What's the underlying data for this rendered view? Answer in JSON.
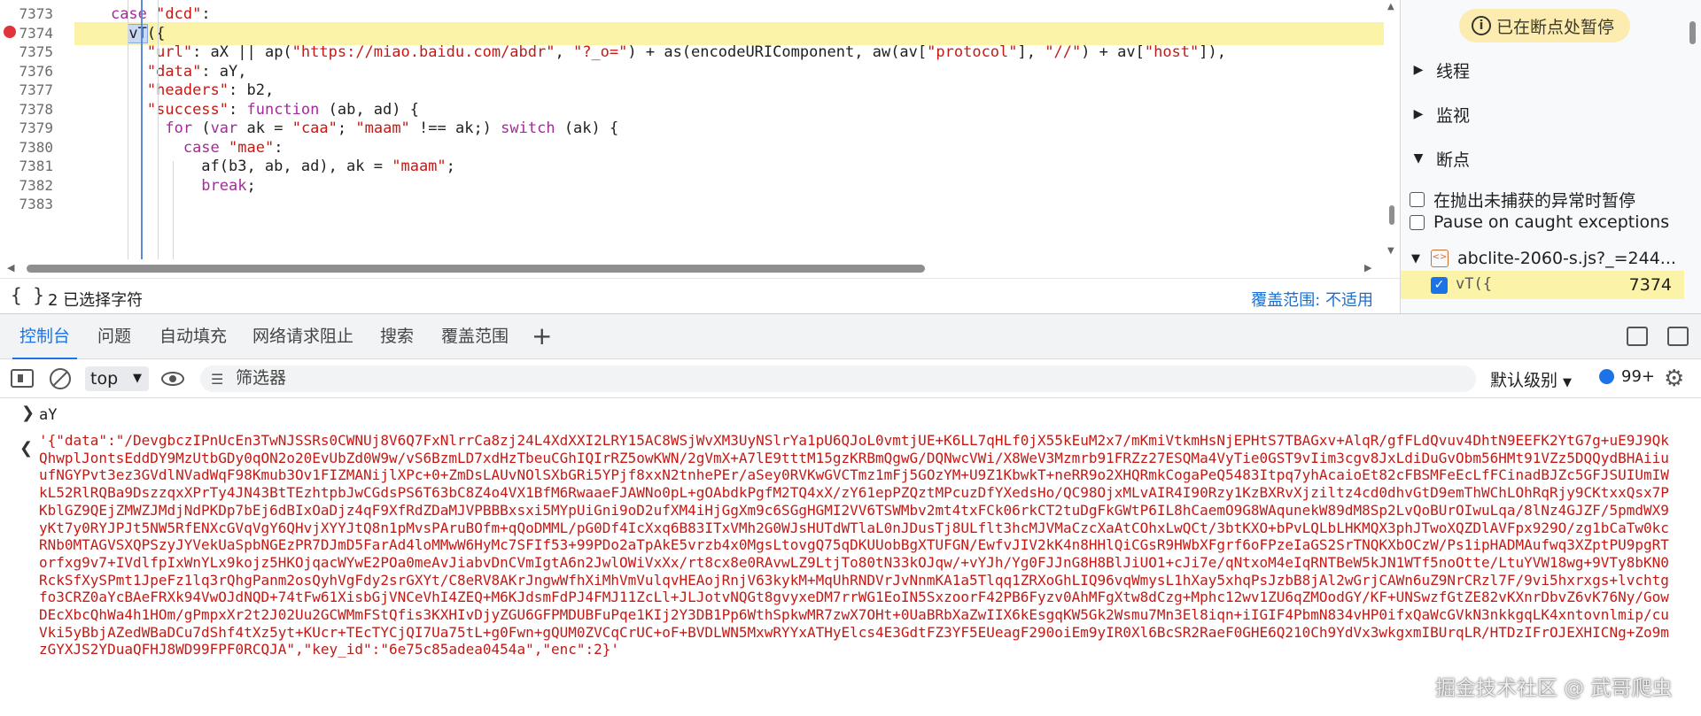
{
  "editor": {
    "line_numbers": [
      "7373",
      "7374",
      "7375",
      "7376",
      "7377",
      "7378",
      "7379",
      "7380",
      "7381",
      "7382",
      "7383"
    ],
    "paused_line": "7374",
    "lines": [
      [
        {
          "t": "    "
        },
        {
          "t": "case ",
          "c": "kw"
        },
        {
          "t": "\"dcd\"",
          "c": "str"
        },
        {
          "t": ":"
        }
      ],
      [
        {
          "t": "      "
        },
        {
          "t": "vT",
          "c": "sel"
        },
        {
          "t": "({"
        }
      ],
      [
        {
          "t": "        "
        },
        {
          "t": "\"url\"",
          "c": "str"
        },
        {
          "t": ": aX || ap("
        },
        {
          "t": "\"https://miao.baidu.com/abdr\"",
          "c": "str"
        },
        {
          "t": ", "
        },
        {
          "t": "\"?_o=\"",
          "c": "str"
        },
        {
          "t": ") + as(encodeURIComponent, aw(av["
        },
        {
          "t": "\"protocol\"",
          "c": "str"
        },
        {
          "t": "], "
        },
        {
          "t": "\"//\"",
          "c": "str"
        },
        {
          "t": ") + av["
        },
        {
          "t": "\"host\"",
          "c": "str"
        },
        {
          "t": "]),"
        }
      ],
      [
        {
          "t": "        "
        },
        {
          "t": "\"data\"",
          "c": "str"
        },
        {
          "t": ": aY,"
        }
      ],
      [
        {
          "t": "        "
        },
        {
          "t": "\"headers\"",
          "c": "str"
        },
        {
          "t": ": b2,"
        }
      ],
      [
        {
          "t": "        "
        },
        {
          "t": "\"success\"",
          "c": "str"
        },
        {
          "t": ": "
        },
        {
          "t": "function",
          "c": "kw"
        },
        {
          "t": " (ab, ad) {"
        }
      ],
      [
        {
          "t": "          "
        },
        {
          "t": "for",
          "c": "kw"
        },
        {
          "t": " ("
        },
        {
          "t": "var",
          "c": "kw"
        },
        {
          "t": " ak = "
        },
        {
          "t": "\"caa\"",
          "c": "str"
        },
        {
          "t": "; "
        },
        {
          "t": "\"maam\"",
          "c": "str"
        },
        {
          "t": " !== ak;) "
        },
        {
          "t": "switch",
          "c": "kw"
        },
        {
          "t": " (ak) {"
        }
      ],
      [
        {
          "t": "            "
        },
        {
          "t": "case ",
          "c": "kw"
        },
        {
          "t": "\"mae\"",
          "c": "str"
        },
        {
          "t": ":"
        }
      ],
      [
        {
          "t": "              af(b3, ab, ad), ak = "
        },
        {
          "t": "\"maam\"",
          "c": "str"
        },
        {
          "t": ";"
        }
      ],
      [
        {
          "t": "              "
        },
        {
          "t": "break",
          "c": "kw"
        },
        {
          "t": ";"
        }
      ],
      [
        {
          "t": ""
        }
      ]
    ],
    "status": {
      "braces": "{ }",
      "selection_text": "2 已选择字符",
      "coverage": "覆盖范围: 不适用"
    }
  },
  "sidebar": {
    "paused_badge": "已在断点处暂停",
    "sections": {
      "threads": "线程",
      "watch": "监视",
      "breakpoints": "断点"
    },
    "pause_uncaught": "在抛出未捕获的异常时暂停",
    "pause_caught": "Pause on caught exceptions",
    "bp_file": "abclite-2060-s.js?_=244...",
    "bp_code": "vT({",
    "bp_line": "7374"
  },
  "drawer": {
    "tabs": [
      "控制台",
      "问题",
      "自动填充",
      "网络请求阻止",
      "搜索",
      "覆盖范围"
    ],
    "active_tab": "控制台",
    "add_tab": "+"
  },
  "console": {
    "context": "top",
    "filter_placeholder": "筛选器",
    "level": "默认级别",
    "issues_count": "99+",
    "input_expr": "aY",
    "result": "'{\"data\":\"/DevgbczIPnUcEn3TwNJSSRs0CWNUj8V6Q7FxNlrrCa8zj24L4XdXXI2LRY15AC8WSjWvXM3UyNSlrYa1pU6QJoL0vmtjUE+K6LL7qHLf0jX55kEuM2x7/mKmiVtkmHsNjEPHtS7TBAGxv+AlqR/gfFLdQvuv4DhtN9EEFK2YtG7g+uE9J9QkQhwplJontsEddDY9MzUtbGDy0qON2o20EvUbZd0W9w/vS6BzmLD7xdHzTbeuCGhIQIrRZ5owKWN/2gVmX+A7lE9tttM15gzKRBmQgwG/DQNwcVWi/X8WeV3Mzmrb91FRZz27ESQMa4VyTie0GST9vIim3cgv8JxLdiDuGvObm56HMt91VZz5DQQydBHAiiuufNGYPvt3ez3GVdlNVadWqF98Kmub3Ov1FIZMANijlXPc+0+ZmDsLAUvNOlSXbGRi5YPjf8xxN2tnhePEr/aSey0RVKwGVCTmz1mFj5GOzYM+U9Z1KbwkT+neRR9o2XHQRmkCogaPeQ5483Itpq7yhAcaioEt82cFBSMFeEcLfFCinadBJZc5GFJSUIUmIWkL52RlRQBa9DszzqxXPrTy4JN43BtTEzhtpbJwCGdsPS6T63bC8Z4o4VX1BfM6RwaaeFJAWNo0pL+gOAbdkPgfM2TQ4xX/zY61epPZQztMPcuzDfYXedsHo/QC98OjxMLvAIR4I90Rzy1KzBXRvXjziltz4cd0dhvGtD9emThWChLOhRqRjy9CKtxxQsx7PKblGZ9QEjZMWZJMdjNdPKDp7bEj6dBIxOaDjz4qF9XfRdZDaMJVPBBBxsxi5MYpUiGni9oD2ufXM4iHjGgXm9c6SGgHGMI2VV6TSWMbv2mt4txFCk06rkCT2tuDgFkGWtP6IL8hCaemO9G8WAqunekW89dM8Sp2LvQoBUrOIwuLqa/8lNz4GJZF/5pmdWX9yKt7y0RYJPJt5NW5RfENXcGVqVgY6QHvjXYYJtQ8n1pMvsPAruBOfm+qQoDMML/pG0Df4IcXxq6B83ITxVMh2G0WJsHUTdWTlaL0nJDusTj8ULflt3hcMJVMaCzcXaAtCOhxLwQCt/3btKXO+bPvLQLbLHKMQX3phJTwoXQZDlAVFpx929O/zg1bCaTw0kcRNb0MTAGVSXQPSzyJYVekUaSpbNGEzPR7DJmD5FarAd4loMMwW6HyMc7SFIf53+99PDo2aTpAkE5vrzb4x0MgsLtovgQ75qDKUUobBgXTUFGN/EwfvJIV2kK4n8HHlQiCGsR9HWbXFgrf6oFPzeIaGS2SrTNQKXbOCzW/Ps1ipHADMAufwq3XZptPU9pgRTorfxg9v7+IVdlfpIxWnYLx9kojz5HKOjqacWYwE2POa0meAvJiabvDnCVmIgtA6n2JwlOWiVxXx/rt8cx8e0RAvwLZ9LtjTo80tN33kOJqw/+vYJh/Yg0FJJnG8H8BlJiUO1+cJi7e/qNtxoM4eIqRNTBeW5kJN1WTf5noOtte/LtuYVW18wg+9VTy8bKN0RckSfXySPmt1JpeFz1lq3rQhgPanm2osQyhVgFdy2srGXYt/C8eRV8AKrJngwWfhXiMhVmVulqvHEAojRnjV63kykM+MqUhRNDVrJvNnmKA1a5Tlqq1ZRXoGhLIQ96vqWmysL1hXay5xhqPsJzbB8jAl2wGrjCAWn6uZ9NrCRzl7F/9vi5hxrxgs+lvchtgfo3CRZ0aYcBAeFRXk94VwOJdNQD+74tFw61XisbGjVNCeVhI4ZEQ+M6KJdsmFdPJ4FMJ11ZcLl+JLJotvNQGt8gvyxeDM7rrWG1EoIN5SxzoorF42PB6Fyzv0AhMFgXtw8dCzg+Mphc12wv1ZU6qZMOodGY/KF+UNSwzfGtZE82vKXnrDbvZ6vK76Ny/GowDEcXbcQhWa4h1HOm/gPmpxXr2t2J02Uu2GCWMmFStQfis3KXHIvDjyZGU6GFPMDUBFuPqe1KIj2Y3DB1Pp6WthSpkwMR7zwX7OHt+0UaBRbXaZwIIX6kEsgqKW5Gk2Wsmu7Mn3El8iqn+iIGIF4PbmN834vHP0ifxQaWcGVkN3nkkgqLK4xntovnlmip/cuVki5yBbjAZedWBaDCu7dShf4tXz5yt+KUcr+TEcTYCjQI7Ua75tL+g0Fwn+gQUM0ZVCqCrUC+oF+BVDLWN5MxwRYYxATHyElcs4E3GdtFZ3YF5EUeagF290oiEm9yIR0Xl6BcSR2RaeF0GHE6Q210Ch9YdVx3wkgxmIBUrqLR/HTDzIFrOJEXHICNg+Zo9mzGYXJS2YDuaQFHJ8WD99FPF0RCQJA\",\"key_id\":\"6e75c85adea0454a\",\"enc\":2}'"
  },
  "watermark": "掘金技术社区 @ 武哥爬虫"
}
